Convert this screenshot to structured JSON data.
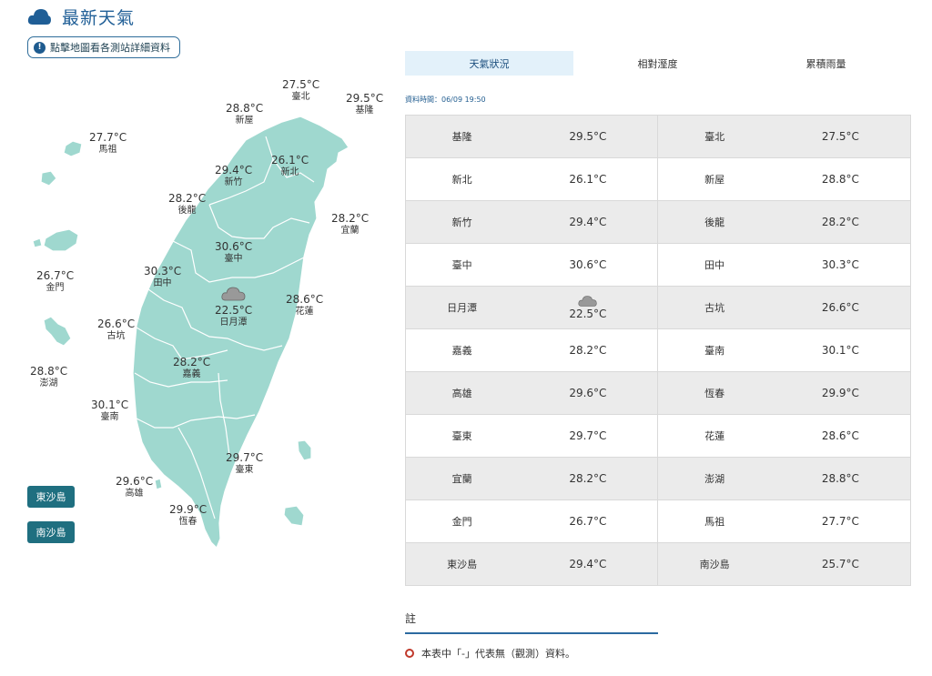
{
  "header": {
    "title": "最新天氣"
  },
  "map_link": {
    "label": "點擊地圖看各測站詳細資料"
  },
  "colors": {
    "accent": "#1f5e96",
    "land": "#9fd8cf",
    "active_tab": "#e3f1fa",
    "island_button": "#1f6f80"
  },
  "map_stations": [
    {
      "id": "taipei",
      "name": "臺北",
      "temp": "27.5°C"
    },
    {
      "id": "keelung",
      "name": "基隆",
      "temp": "29.5°C"
    },
    {
      "id": "xinwu",
      "name": "新屋",
      "temp": "28.8°C"
    },
    {
      "id": "mazu",
      "name": "馬祖",
      "temp": "27.7°C"
    },
    {
      "id": "xinbei",
      "name": "新北",
      "temp": "26.1°C"
    },
    {
      "id": "hsinchu",
      "name": "新竹",
      "temp": "29.4°C"
    },
    {
      "id": "houlong",
      "name": "後龍",
      "temp": "28.2°C"
    },
    {
      "id": "yilan",
      "name": "宜蘭",
      "temp": "28.2°C"
    },
    {
      "id": "taichung",
      "name": "臺中",
      "temp": "30.6°C"
    },
    {
      "id": "kinmen",
      "name": "金門",
      "temp": "26.7°C"
    },
    {
      "id": "tianzhong",
      "name": "田中",
      "temp": "30.3°C"
    },
    {
      "id": "hualien",
      "name": "花蓮",
      "temp": "28.6°C"
    },
    {
      "id": "sunmoonlake",
      "name": "日月潭",
      "temp": "22.5°C",
      "icon": "cloud-icon"
    },
    {
      "id": "gukeng",
      "name": "古坑",
      "temp": "26.6°C"
    },
    {
      "id": "chiayi",
      "name": "嘉義",
      "temp": "28.2°C"
    },
    {
      "id": "penghu",
      "name": "澎湖",
      "temp": "28.8°C"
    },
    {
      "id": "tainan",
      "name": "臺南",
      "temp": "30.1°C"
    },
    {
      "id": "taitung",
      "name": "臺東",
      "temp": "29.7°C"
    },
    {
      "id": "kaohsiung",
      "name": "高雄",
      "temp": "29.6°C"
    },
    {
      "id": "hengchun",
      "name": "恆春",
      "temp": "29.9°C"
    }
  ],
  "island_buttons": [
    {
      "label": "東沙島"
    },
    {
      "label": "南沙島"
    }
  ],
  "tabs": [
    {
      "label": "天氣狀況",
      "active": true
    },
    {
      "label": "相對溼度",
      "active": false
    },
    {
      "label": "累積雨量",
      "active": false
    }
  ],
  "data_time": "資料時間：06/09 19:50",
  "table_rows": [
    [
      "基隆",
      "29.5°C",
      "臺北",
      "27.5°C"
    ],
    [
      "新北",
      "26.1°C",
      "新屋",
      "28.8°C"
    ],
    [
      "新竹",
      "29.4°C",
      "後龍",
      "28.2°C"
    ],
    [
      "臺中",
      "30.6°C",
      "田中",
      "30.3°C"
    ],
    [
      "日月潭",
      "22.5°C",
      "古坑",
      "26.6°C"
    ],
    [
      "嘉義",
      "28.2°C",
      "臺南",
      "30.1°C"
    ],
    [
      "高雄",
      "29.6°C",
      "恆春",
      "29.9°C"
    ],
    [
      "臺東",
      "29.7°C",
      "花蓮",
      "28.6°C"
    ],
    [
      "宜蘭",
      "28.2°C",
      "澎湖",
      "28.8°C"
    ],
    [
      "金門",
      "26.7°C",
      "馬祖",
      "27.7°C"
    ],
    [
      "東沙島",
      "29.4°C",
      "南沙島",
      "25.7°C"
    ]
  ],
  "table_icons": {
    "4": "cloud-icon"
  },
  "note": {
    "title": "註",
    "items": [
      "本表中「-」代表無（觀測）資料。"
    ]
  }
}
